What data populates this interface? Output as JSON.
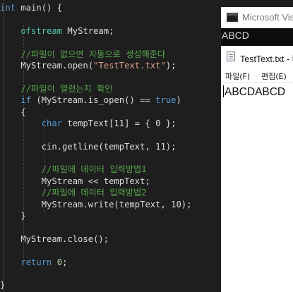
{
  "editor": {
    "lines": [
      {
        "parts": [
          {
            "t": "int",
            "c": "kw"
          },
          {
            "t": " main() {",
            "c": ""
          }
        ]
      },
      {
        "parts": []
      },
      {
        "parts": [
          {
            "t": "    ",
            "c": ""
          },
          {
            "t": "ofstream",
            "c": "ty"
          },
          {
            "t": " MyStream;",
            "c": ""
          }
        ]
      },
      {
        "parts": []
      },
      {
        "parts": [
          {
            "t": "    //파일이 없으면 자동으로 생성해준다",
            "c": "cmt"
          }
        ]
      },
      {
        "parts": [
          {
            "t": "    MyStream.open(",
            "c": ""
          },
          {
            "t": "\"TestText.txt\"",
            "c": "str"
          },
          {
            "t": ");",
            "c": ""
          }
        ]
      },
      {
        "parts": []
      },
      {
        "parts": [
          {
            "t": "    //파일이 열렸는지 확인",
            "c": "cmt"
          }
        ]
      },
      {
        "parts": [
          {
            "t": "    ",
            "c": ""
          },
          {
            "t": "if",
            "c": "kw"
          },
          {
            "t": " (MyStream.is_open() == ",
            "c": ""
          },
          {
            "t": "true",
            "c": "kw"
          },
          {
            "t": ")",
            "c": ""
          }
        ]
      },
      {
        "parts": [
          {
            "t": "    {",
            "c": ""
          }
        ]
      },
      {
        "parts": [
          {
            "t": "        ",
            "c": ""
          },
          {
            "t": "char",
            "c": "kw"
          },
          {
            "t": " tempText[11] = { 0 };",
            "c": ""
          }
        ]
      },
      {
        "parts": []
      },
      {
        "parts": [
          {
            "t": "        cin.getline(tempText, 11);",
            "c": ""
          }
        ]
      },
      {
        "parts": []
      },
      {
        "parts": [
          {
            "t": "        //파일에 데이터 입력방법1",
            "c": "cmt"
          }
        ]
      },
      {
        "parts": [
          {
            "t": "        MyStream << tempText;",
            "c": ""
          }
        ]
      },
      {
        "parts": [
          {
            "t": "        //파일에 데이터 입력방법2",
            "c": "cmt"
          }
        ]
      },
      {
        "parts": [
          {
            "t": "        MyStream.write(tempText, 10);",
            "c": ""
          }
        ]
      },
      {
        "parts": [
          {
            "t": "    }",
            "c": ""
          }
        ]
      },
      {
        "parts": []
      },
      {
        "parts": [
          {
            "t": "    MyStream.close();",
            "c": ""
          }
        ]
      },
      {
        "parts": []
      },
      {
        "parts": [
          {
            "t": "    ",
            "c": ""
          },
          {
            "t": "return",
            "c": "kw"
          },
          {
            "t": " ",
            "c": ""
          },
          {
            "t": "0",
            "c": "num"
          },
          {
            "t": ";",
            "c": ""
          }
        ]
      },
      {
        "parts": []
      },
      {
        "parts": [
          {
            "t": "}",
            "c": ""
          }
        ]
      }
    ]
  },
  "console": {
    "title": "Microsoft Vis",
    "output": "ABCD"
  },
  "notepad": {
    "title": "TestText.txt - 메",
    "menu": {
      "file": "파일(F)",
      "edit": "편집(E)"
    },
    "content": "ABCDABCD"
  }
}
